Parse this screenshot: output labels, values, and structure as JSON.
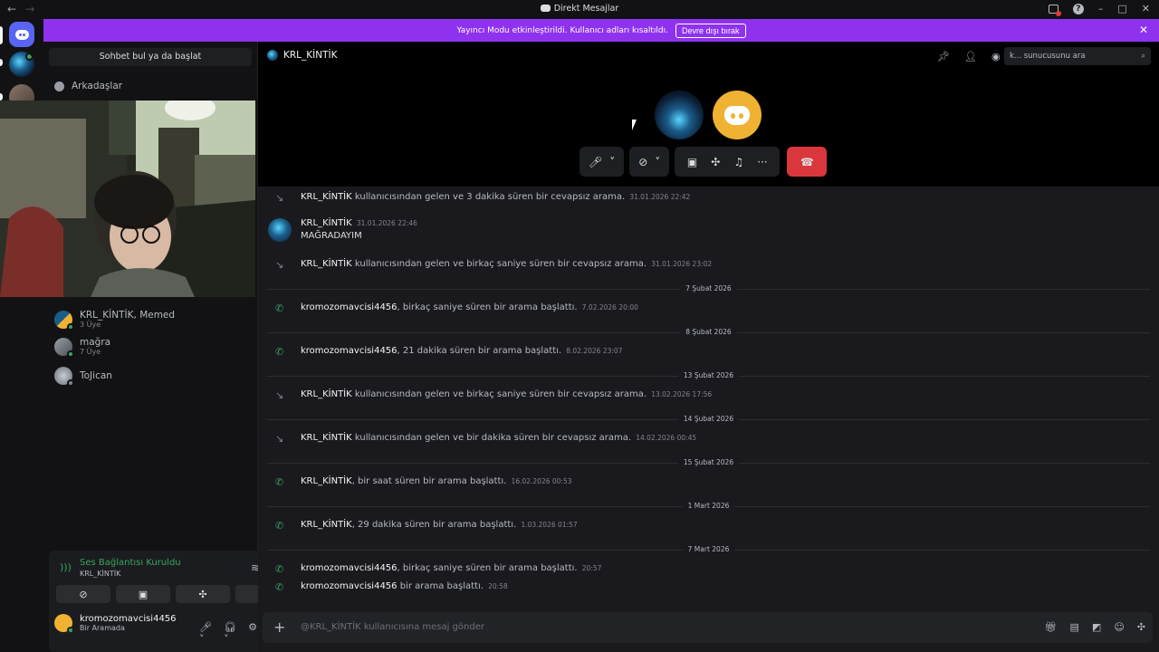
{
  "window": {
    "title": "Direkt Mesajlar"
  },
  "banner": {
    "text": "Yayıncı Modu etkinleştirildi. Kullanıcı adları kısaltıldı.",
    "button": "Devre dışı bırak",
    "color": "#8f32f0"
  },
  "sidebar": {
    "search_label": "Sohbet bul ya da başlat",
    "friends_label": "Arkadaşlar",
    "dms": [
      {
        "name": "KRL_KİNTİK, Memed",
        "sub": "3 Üye"
      },
      {
        "name": "mağra",
        "sub": "7 Üye"
      },
      {
        "name": "ToJican",
        "sub": ""
      }
    ]
  },
  "voice": {
    "status": "Ses Bağlantısı Kuruldu",
    "channel": "KRL_KİNTİK"
  },
  "user": {
    "name": "kromozomavcisi4456",
    "status": "Bir Aramada"
  },
  "header": {
    "channel_name": "KRL_KİNTİK",
    "search_placeholder": "k... sunucusunu ara"
  },
  "messages": [
    {
      "type": "missed",
      "author": "KRL_KİNTİK",
      "text": " kullanıcısından gelen ve 3 dakika süren bir cevapsız arama.",
      "time": "31.01.2026 22:42"
    },
    {
      "type": "message",
      "author": "KRL_KİNTİK",
      "time": "31.01.2026 22:46",
      "text": "MAĞRADAYIM"
    },
    {
      "type": "missed",
      "author": "KRL_KİNTİK",
      "text": " kullanıcısından gelen ve birkaç saniye süren bir cevapsız arama.",
      "time": "31.01.2026 23:02"
    },
    {
      "type": "separator",
      "text": "7 Şubat 2026"
    },
    {
      "type": "call",
      "author": "kromozomavcisi4456",
      "text": ", birkaç saniye süren bir arama başlattı.",
      "time": "7.02.2026 20:00"
    },
    {
      "type": "separator",
      "text": "8 Şubat 2026"
    },
    {
      "type": "call",
      "author": "kromozomavcisi4456",
      "text": ", 21 dakika süren bir arama başlattı.",
      "time": "8.02.2026 23:07"
    },
    {
      "type": "separator",
      "text": "13 Şubat 2026"
    },
    {
      "type": "missed",
      "author": "KRL_KİNTİK",
      "text": " kullanıcısından gelen ve birkaç saniye süren bir cevapsız arama.",
      "time": "13.02.2026 17:56"
    },
    {
      "type": "separator",
      "text": "14 Şubat 2026"
    },
    {
      "type": "missed",
      "author": "KRL_KİNTİK",
      "text": " kullanıcısından gelen ve bir dakika süren bir cevapsız arama.",
      "time": "14.02.2026 00:45"
    },
    {
      "type": "separator",
      "text": "15 Şubat 2026"
    },
    {
      "type": "call",
      "author": "KRL_KİNTİK",
      "text": ", bir saat süren bir arama başlattı.",
      "time": "16.02.2026 00:53"
    },
    {
      "type": "separator",
      "text": "1 Mart 2026"
    },
    {
      "type": "call",
      "author": "KRL_KİNTİK",
      "text": ", 29 dakika süren bir arama başlattı.",
      "time": "1.03.2026 01:57"
    },
    {
      "type": "separator",
      "text": "7 Mart 2026"
    },
    {
      "type": "call",
      "author": "kromozomavcisi4456",
      "text": ", birkaç saniye süren bir arama başlattı.",
      "time": "20:57"
    },
    {
      "type": "call",
      "author": "kromozomavcisi4456",
      "text": " bir arama başlattı.",
      "time": "20:58"
    }
  ],
  "composer": {
    "placeholder": "@KRL_KİNTİK kullanıcısına mesaj gönder"
  },
  "colors": {
    "accent": "#5865f2",
    "online": "#3ba55d",
    "hangup": "#da373c",
    "avatar_yellow": "#f0b232"
  }
}
